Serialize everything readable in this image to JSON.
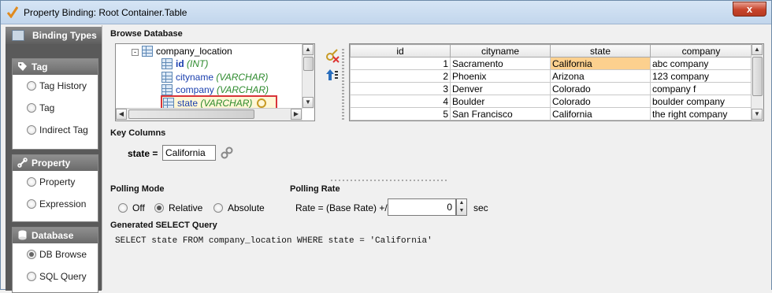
{
  "window": {
    "title": "Property Binding: Root Container.Table",
    "close_label": "x"
  },
  "sidebar": {
    "header": "Binding Types",
    "groups": [
      {
        "label": "Tag",
        "items": [
          {
            "label": "Tag History",
            "selected": false
          },
          {
            "label": "Tag",
            "selected": false
          },
          {
            "label": "Indirect Tag",
            "selected": false
          }
        ]
      },
      {
        "label": "Property",
        "items": [
          {
            "label": "Property",
            "selected": false
          },
          {
            "label": "Expression",
            "selected": false
          }
        ]
      },
      {
        "label": "Database",
        "items": [
          {
            "label": "DB Browse",
            "selected": true
          },
          {
            "label": "SQL Query",
            "selected": false
          }
        ]
      }
    ]
  },
  "browse": {
    "label": "Browse Database",
    "tree": {
      "table_name": "company_location",
      "columns": [
        {
          "name": "id",
          "type": "(INT)"
        },
        {
          "name": "cityname",
          "type": "(VARCHAR)"
        },
        {
          "name": "company",
          "type": "(VARCHAR)"
        },
        {
          "name": "state",
          "type": "(VARCHAR)"
        }
      ]
    }
  },
  "results": {
    "headers": [
      "id",
      "cityname",
      "state",
      "company"
    ],
    "rows": [
      [
        "1",
        "Sacramento",
        "California",
        "abc company"
      ],
      [
        "2",
        "Phoenix",
        "Arizona",
        "123 company"
      ],
      [
        "3",
        "Denver",
        "Colorado",
        "company f"
      ],
      [
        "4",
        "Boulder",
        "Colorado",
        "boulder company"
      ],
      [
        "5",
        "San Francisco",
        "California",
        "the right company"
      ]
    ]
  },
  "key_columns": {
    "label": "Key Columns",
    "key_label": "state =",
    "value": "California"
  },
  "polling_mode": {
    "label": "Polling Mode",
    "options": [
      {
        "label": "Off",
        "selected": false
      },
      {
        "label": "Relative",
        "selected": true
      },
      {
        "label": "Absolute",
        "selected": false
      }
    ]
  },
  "polling_rate": {
    "label": "Polling Rate",
    "rate_label": "Rate = (Base Rate) +/-",
    "value": "0",
    "unit": "sec"
  },
  "query": {
    "label": "Generated SELECT Query",
    "sql": "SELECT state FROM company_location WHERE state = 'California'"
  },
  "colors": {
    "highlight": "#fcd08e",
    "selection_border": "#d9343a",
    "column_name": "#1a3fae",
    "column_type": "#2c8a2c",
    "close_button": "#c7432a"
  }
}
